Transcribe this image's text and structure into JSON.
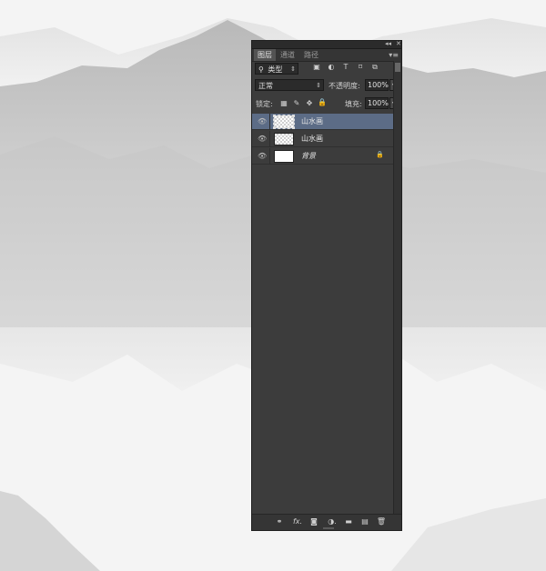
{
  "panel": {
    "tabs": [
      {
        "label": "图层",
        "active": true
      },
      {
        "label": "通道",
        "active": false
      },
      {
        "label": "路径",
        "active": false
      }
    ],
    "title_controls": {
      "collapse": "◂◂",
      "close": "✕"
    },
    "menu_icon": "menu-icon"
  },
  "filter": {
    "search_glyph": "⚲",
    "kind_value": "类型",
    "icons": [
      {
        "name": "pixel-layer-filter-icon",
        "glyph": "▣"
      },
      {
        "name": "adjustment-layer-filter-icon",
        "glyph": "◐"
      },
      {
        "name": "type-layer-filter-icon",
        "glyph": "T"
      },
      {
        "name": "shape-layer-filter-icon",
        "glyph": "⌑"
      },
      {
        "name": "smart-object-filter-icon",
        "glyph": "⧉"
      }
    ]
  },
  "blend": {
    "mode_value": "正常",
    "opacity_label": "不透明度:",
    "opacity_value": "100%"
  },
  "lock": {
    "label": "锁定:",
    "icons": [
      {
        "name": "lock-transparent-pixels-icon",
        "glyph": "▦"
      },
      {
        "name": "lock-image-pixels-icon",
        "glyph": "✎"
      },
      {
        "name": "lock-position-icon",
        "glyph": "✥"
      },
      {
        "name": "lock-all-icon",
        "glyph": "🔒"
      }
    ],
    "fill_label": "填充:",
    "fill_value": "100%"
  },
  "layers": [
    {
      "name": "山水画",
      "selected": true,
      "thumb": "transparent",
      "locked": false,
      "italic": false
    },
    {
      "name": "山水画",
      "selected": false,
      "thumb": "transparent",
      "locked": false,
      "italic": false
    },
    {
      "name": "背景",
      "selected": false,
      "thumb": "white",
      "locked": true,
      "italic": true
    }
  ],
  "bottom_icons": [
    {
      "name": "link-layers-icon",
      "glyph": "⚭"
    },
    {
      "name": "layer-style-fx-icon",
      "glyph": "fx."
    },
    {
      "name": "add-mask-icon",
      "glyph": "◙"
    },
    {
      "name": "new-adjustment-layer-icon",
      "glyph": "◑."
    },
    {
      "name": "new-group-icon",
      "glyph": "▬"
    },
    {
      "name": "new-layer-icon",
      "glyph": "▤"
    },
    {
      "name": "delete-layer-icon",
      "glyph": "🗑"
    }
  ],
  "colors": {
    "panel_bg": "#3c3c3c",
    "selected_layer": "#5c6c86",
    "canvas_bg": "#f2f2f2"
  }
}
